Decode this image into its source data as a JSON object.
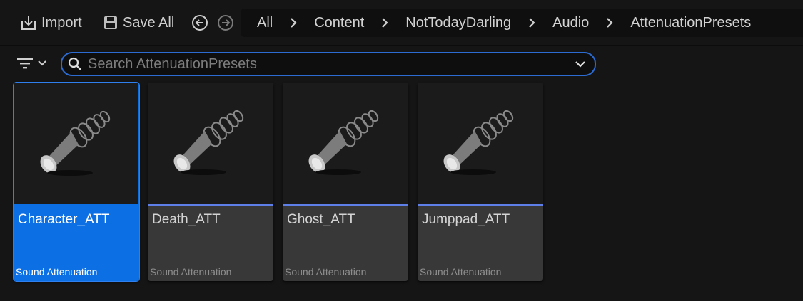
{
  "toolbar": {
    "import_label": "Import",
    "save_all_label": "Save All"
  },
  "breadcrumb": [
    "All",
    "Content",
    "NotTodayDarling",
    "Audio",
    "AttenuationPresets"
  ],
  "search": {
    "placeholder": "Search AttenuationPresets",
    "value": ""
  },
  "assets": [
    {
      "name": "Character_ATT",
      "type": "Sound Attenuation",
      "selected": true
    },
    {
      "name": "Death_ATT",
      "type": "Sound Attenuation",
      "selected": false
    },
    {
      "name": "Ghost_ATT",
      "type": "Sound Attenuation",
      "selected": false
    },
    {
      "name": "Jumppad_ATT",
      "type": "Sound Attenuation",
      "selected": false
    }
  ],
  "colors": {
    "accent": "#2c6bd2",
    "selection": "#0c70e4",
    "asset_type_bar": "#5f7fe8",
    "background": "#151515"
  },
  "icons": {
    "import": "import-icon",
    "save_all": "save-all-icon",
    "back": "back-arrow-icon",
    "forward": "forward-arrow-icon",
    "filter": "filter-icon",
    "search": "search-icon",
    "dropdown": "chevron-down-icon",
    "asset_thumbnail": "sound-attenuation-speaker-icon"
  }
}
